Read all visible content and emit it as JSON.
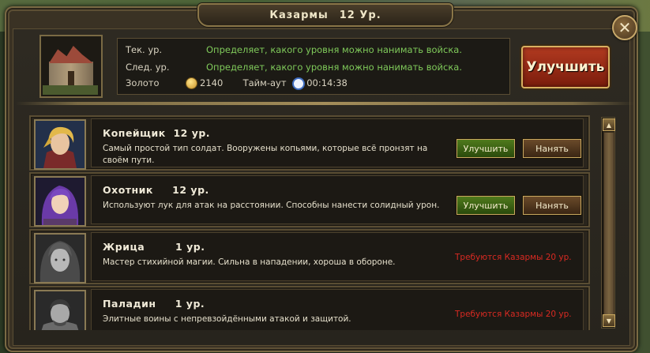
{
  "window": {
    "title": "Казармы",
    "level": "12 Ур.",
    "close_label": "✕"
  },
  "info": {
    "current_label": "Тек. ур.",
    "current_value": "Определяет, какого уровня можно нанимать войска.",
    "next_label": "След. ур.",
    "next_value": "Определяет, какого уровня можно нанимать войска.",
    "gold_label": "Золото",
    "gold_value": "2140",
    "timeout_label": "Тайм-аут",
    "timeout_value": "00:14:38"
  },
  "upgrade_button": "Улучшить",
  "units": [
    {
      "name": "Копейщик",
      "level": "12 ур.",
      "description": "Самый простой тип солдат. Вооружены копьями, которые всё пронзят на своём пути.",
      "upgrade_label": "Улучшить",
      "hire_label": "Нанять",
      "requirement": ""
    },
    {
      "name": "Охотник",
      "level": "12 ур.",
      "description": "Используют лук для атак на расстоянии. Способны нанести солидный урон.",
      "upgrade_label": "Улучшить",
      "hire_label": "Нанять",
      "requirement": ""
    },
    {
      "name": "Жрица",
      "level": "1 ур.",
      "description": "Мастер стихийной магии. Сильна в нападении, хороша в обороне.",
      "requirement": "Требуются Казармы  20 ур."
    },
    {
      "name": "Паладин",
      "level": "1 ур.",
      "description": "Элитные воины с непревзойдёнными атакой и защитой.",
      "requirement": "Требуются Казармы  20 ур."
    }
  ],
  "colors": {
    "accent_green": "#7fc95a",
    "requirement_red": "#d92a22",
    "gold_border": "#c9a860"
  },
  "icons": {
    "close": "close-icon",
    "coin": "gold-coin-icon",
    "clock": "clock-icon",
    "scroll_up": "arrow-up-icon",
    "scroll_down": "arrow-down-icon"
  }
}
